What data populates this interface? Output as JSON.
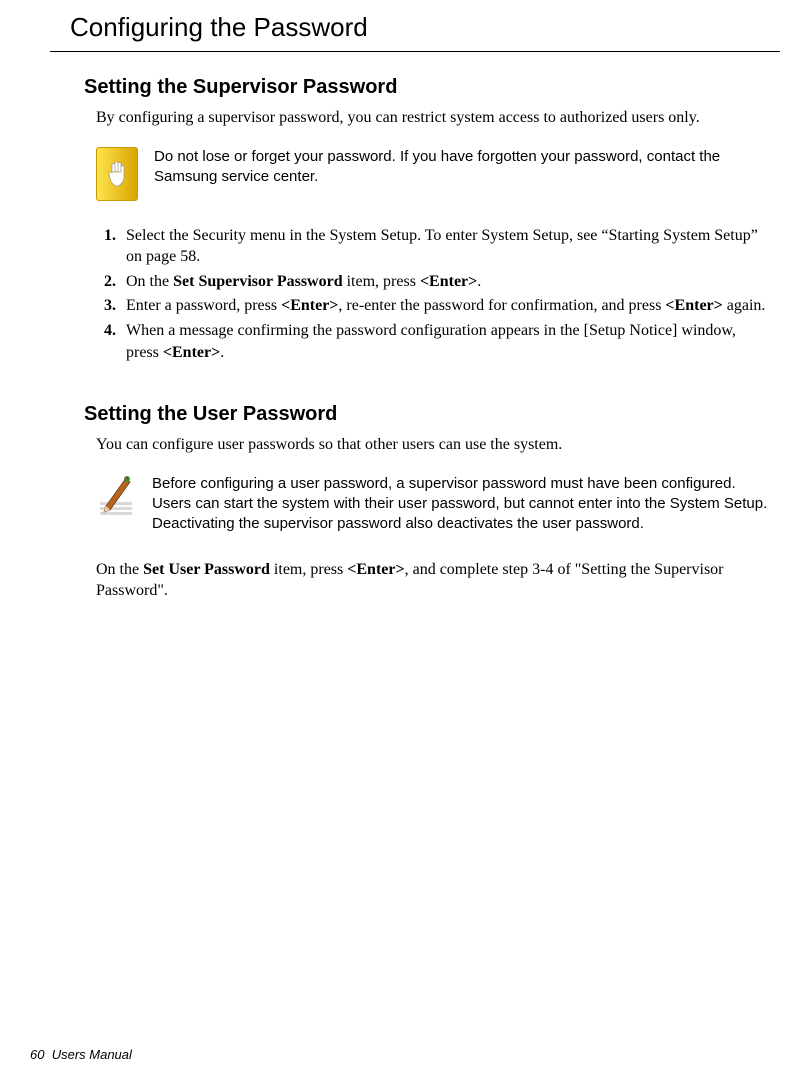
{
  "title": "Configuring the Password",
  "section1": {
    "heading": "Setting the Supervisor Password",
    "intro": "By configuring a supervisor password, you can restrict system access to authorized users only.",
    "caution": "Do not lose or forget your password. If you have forgotten your password, contact the Samsung service center.",
    "steps": {
      "s1": "Select the Security menu in the System Setup. To enter System Setup, see “Starting System Setup” on page 58.",
      "s2a": "On the ",
      "s2b": "Set Supervisor Password",
      "s2c": " item, press ",
      "s2d": "<Enter>",
      "s2e": ".",
      "s3a": "Enter a password, press ",
      "s3b": "<Enter>",
      "s3c": ", re-enter the password for confirmation, and press ",
      "s3d": "<Enter>",
      "s3e": " again.",
      "s4a": "When a message confirming the password configuration appears in the [Setup Notice] window, press ",
      "s4b": "<Enter>",
      "s4c": "."
    }
  },
  "section2": {
    "heading": "Setting the User Password",
    "intro": "You can configure user passwords so that other users can use the system.",
    "note": {
      "l1": "Before configuring a user password, a supervisor password must have been configured.",
      "l2": "Users can start the system with their user password, but cannot enter into the System Setup.",
      "l3": "Deactivating the supervisor password also deactivates the user password."
    },
    "closing": {
      "c1": "On the ",
      "c2": "Set User Password",
      "c3": " item, press ",
      "c4": "<Enter>",
      "c5": ", and complete step 3-4 of \"Setting the Supervisor Password\"."
    }
  },
  "footer": {
    "page": "60",
    "label": "Users Manual"
  }
}
